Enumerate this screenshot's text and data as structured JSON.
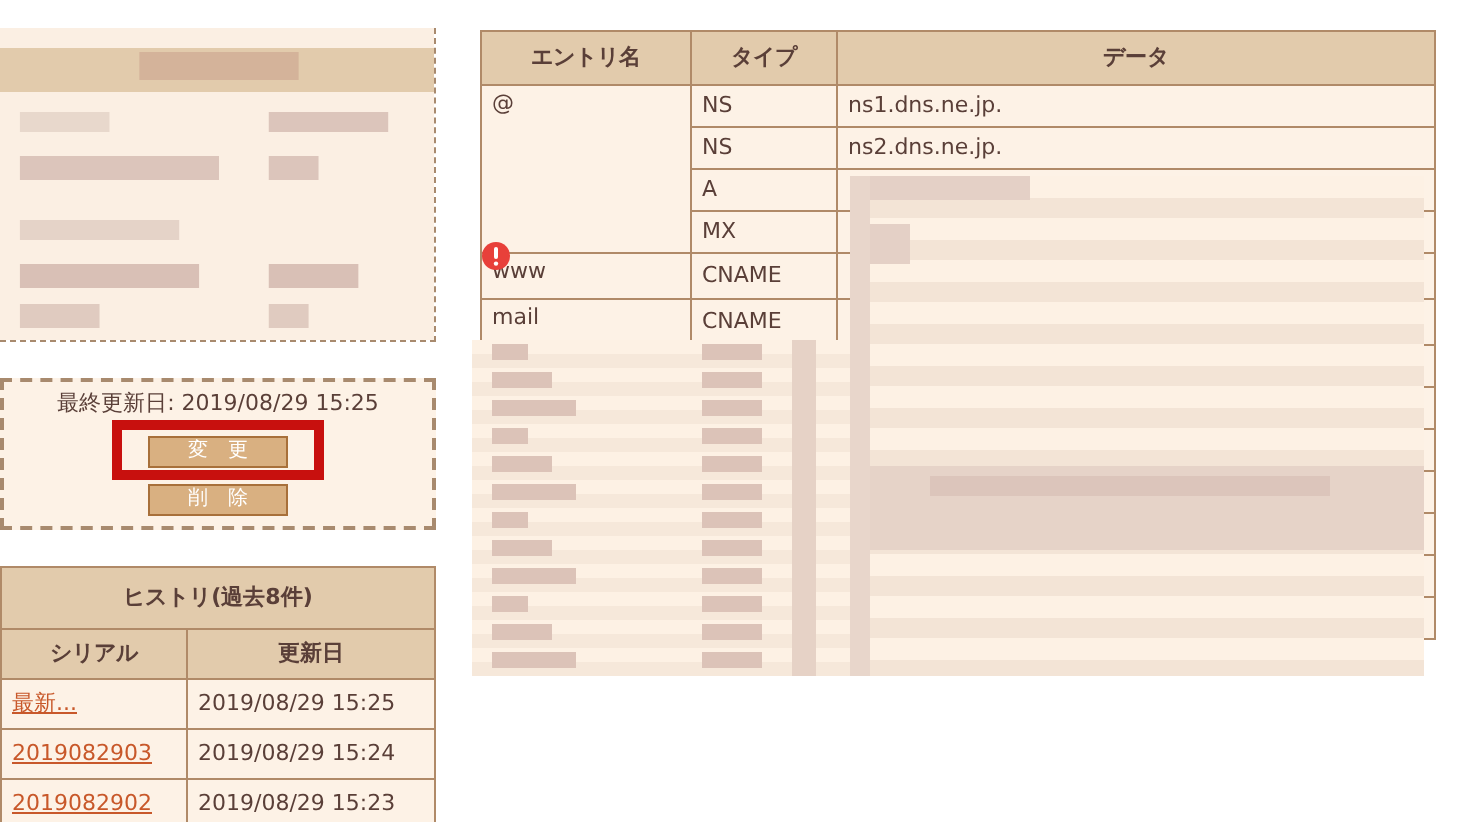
{
  "info": {
    "last_updated": "最終更新日: 2019/08/29 15:25",
    "buttons": [
      "変　更",
      "削　除"
    ]
  },
  "annotations": [
    {
      "kind": "frame"
    }
  ],
  "history": {
    "title": "ヒストリ(過去8件)",
    "columns": [
      "シリアル",
      "更新日"
    ],
    "rows": [
      {
        "serial": "最新...",
        "date": "2019/08/29 15:25"
      },
      {
        "serial": "2019082903",
        "date": "2019/08/29 15:24"
      },
      {
        "serial": "2019082902",
        "date": "2019/08/29 15:23"
      }
    ]
  },
  "records": {
    "columns": [
      "エントリ名",
      "タイプ",
      "データ"
    ],
    "entries": [
      {
        "kind": "record",
        "name": "@",
        "warning": false,
        "rows": [
          {
            "type": "NS",
            "data": "ns1.dns.ne.jp."
          },
          {
            "type": "NS",
            "data": "ns2.dns.ne.jp."
          },
          {
            "type": "A"
          },
          {
            "type": "MX"
          }
        ]
      },
      {
        "kind": "record",
        "name": "www",
        "warning": true,
        "rows": [
          {
            "type": "CNAME"
          }
        ]
      },
      {
        "kind": "record",
        "name": "mail",
        "warning": false,
        "rows": [
          {
            "type": "CNAME"
          }
        ]
      },
      {
        "kind": "redacted"
      },
      {
        "kind": "redacted"
      },
      {
        "kind": "redacted"
      },
      {
        "kind": "redacted"
      },
      {
        "kind": "redacted"
      },
      {
        "kind": "redacted"
      },
      {
        "kind": "redacted"
      }
    ]
  }
}
